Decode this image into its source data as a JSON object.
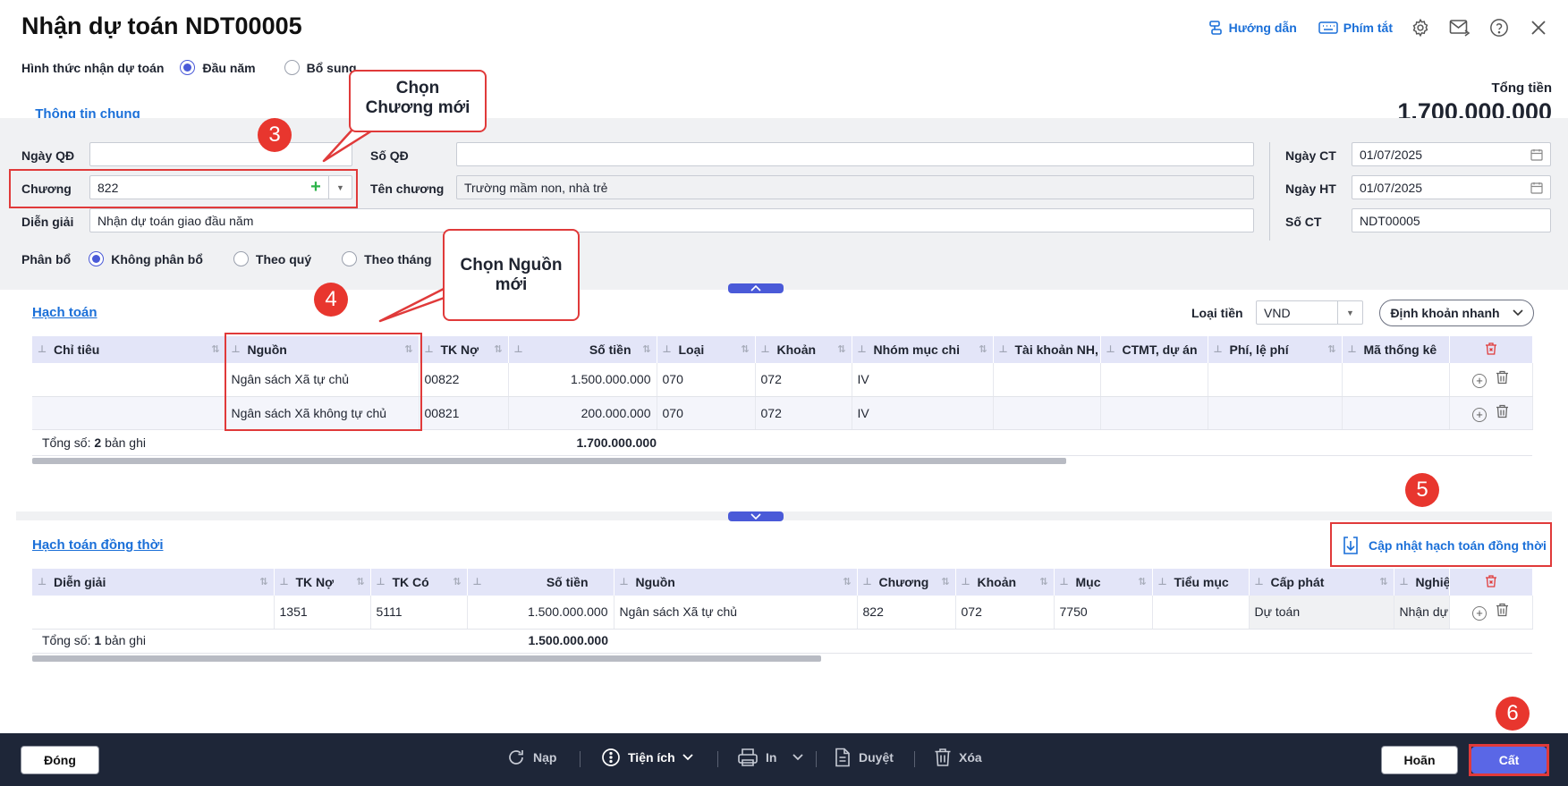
{
  "header": {
    "title": "Nhận dự toán NDT00005",
    "guide_label": "Hướng dẫn",
    "shortcut_label": "Phím tắt"
  },
  "receive_form": {
    "label": "Hình thức nhận dự toán",
    "options": [
      "Đầu năm",
      "Bổ sung"
    ],
    "selected": "Đầu năm"
  },
  "total": {
    "label": "Tổng tiền",
    "value": "1.700.000.000"
  },
  "tabs": [
    {
      "label": "Thông tin chung",
      "active": true
    }
  ],
  "form": {
    "ngay_qd_label": "Ngày QĐ",
    "ngay_qd_value": "",
    "so_qd_label": "Số QĐ",
    "so_qd_value": "",
    "chuong_label": "Chương",
    "chuong_value": "822",
    "ten_chuong_label": "Tên chương",
    "ten_chuong_value": "Trường mầm non, nhà trẻ",
    "dien_giai_label": "Diễn giải",
    "dien_giai_value": "Nhận dự toán giao đầu năm",
    "ngay_ct_label": "Ngày CT",
    "ngay_ct_value": "01/07/2025",
    "ngay_ht_label": "Ngày HT",
    "ngay_ht_value": "01/07/2025",
    "so_ct_label": "Số CT",
    "so_ct_value": "NDT00005",
    "phan_bo_label": "Phân bổ",
    "phan_bo_options": [
      "Không phân bổ",
      "Theo quý",
      "Theo tháng"
    ],
    "phan_bo_selected": "Không phân bổ"
  },
  "hach_toan": {
    "title": "Hạch toán",
    "currency_label": "Loại tiền",
    "currency_value": "VND",
    "quick_label": "Định khoản nhanh",
    "columns": [
      "Chỉ tiêu",
      "Nguồn",
      "TK Nợ",
      "Số tiền",
      "Loại",
      "Khoản",
      "Nhóm mục chi",
      "Tài khoản NH,",
      "CTMT, dự án",
      "Phí, lệ phí",
      "Mã thống kê"
    ],
    "rows": [
      [
        "",
        "Ngân sách Xã tự chủ",
        "00822",
        "1.500.000.000",
        "070",
        "072",
        "IV",
        "",
        "",
        "",
        ""
      ],
      [
        "",
        "Ngân sách Xã không tự chủ",
        "00821",
        "200.000.000",
        "070",
        "072",
        "IV",
        "",
        "",
        "",
        ""
      ]
    ],
    "summary_label": "Tổng số:",
    "summary_count": "2",
    "summary_unit": "bản ghi",
    "summary_total": "1.700.000.000"
  },
  "dong_thoi": {
    "title": "Hạch toán đồng thời",
    "update_label": "Cập nhật hạch toán đồng thời",
    "columns": [
      "Diễn giải",
      "TK Nợ",
      "TK Có",
      "Số tiền",
      "Nguồn",
      "Chương",
      "Khoản",
      "Mục",
      "Tiểu mục",
      "Cấp phát",
      "Nghiệp"
    ],
    "rows": [
      [
        "",
        "1351",
        "5111",
        "1.500.000.000",
        "Ngân sách Xã tự chủ",
        "822",
        "072",
        "7750",
        "",
        "Dự toán",
        "Nhận dự"
      ]
    ],
    "summary_label": "Tổng số:",
    "summary_count": "1",
    "summary_unit": "bản ghi",
    "summary_total": "1.500.000.000"
  },
  "callouts": {
    "c3_line1": "Chọn",
    "c3_line2": "Chương mới",
    "c4_line1": "Chọn Nguồn",
    "c4_line2": "mới",
    "b3": "3",
    "b4": "4",
    "b5": "5",
    "b6": "6"
  },
  "footer": {
    "close": "Đóng",
    "reload": "Nạp",
    "utility": "Tiện ích",
    "print": "In",
    "approve": "Duyệt",
    "delete": "Xóa",
    "cancel": "Hoãn",
    "save": "Cất"
  },
  "colors": {
    "accent": "#4a5ad8",
    "link": "#1a6fd8",
    "annotation": "#e03a3a",
    "footer_bg": "#1e2638"
  }
}
